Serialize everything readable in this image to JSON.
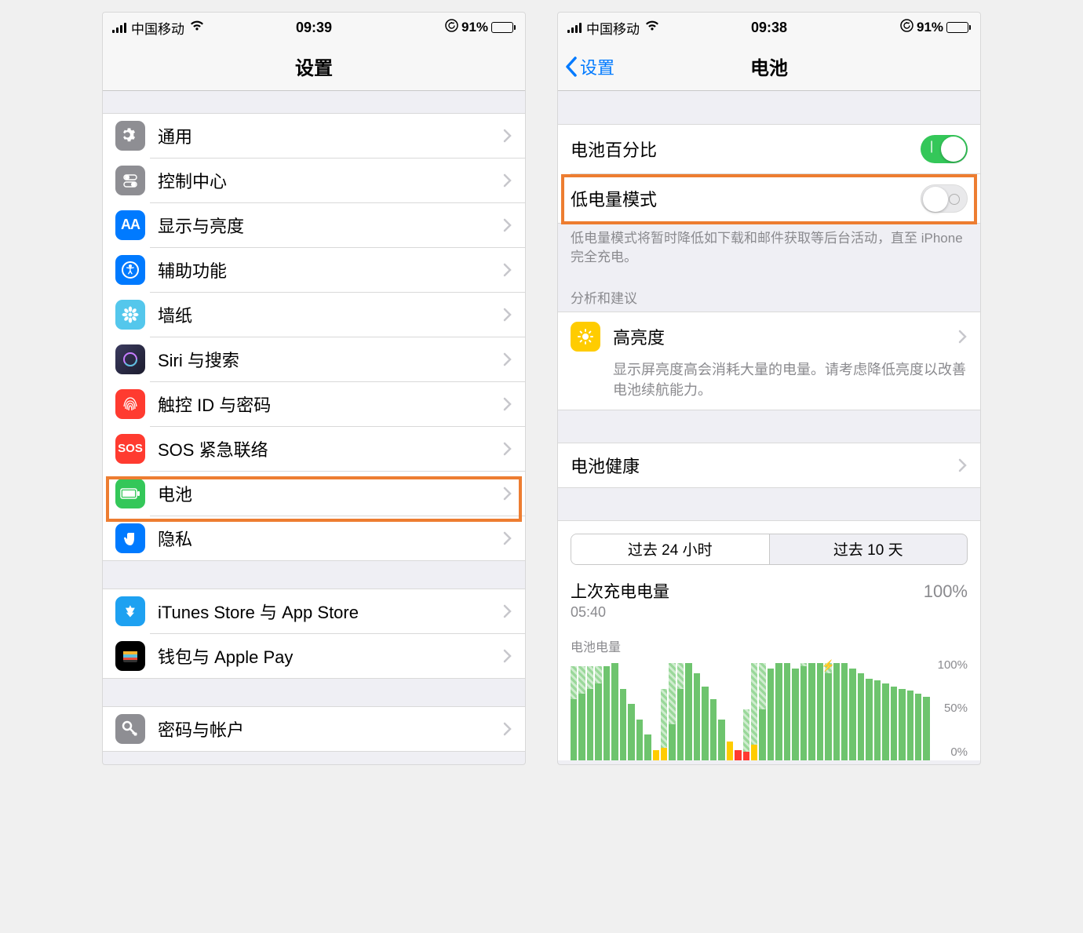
{
  "left": {
    "status": {
      "carrier": "中国移动",
      "time": "09:39",
      "battery": "91%"
    },
    "nav": {
      "title": "设置"
    },
    "items": [
      {
        "id": "general",
        "label": "通用"
      },
      {
        "id": "control",
        "label": "控制中心"
      },
      {
        "id": "display",
        "label": "显示与亮度"
      },
      {
        "id": "access",
        "label": "辅助功能"
      },
      {
        "id": "wallpaper",
        "label": "墙纸"
      },
      {
        "id": "siri",
        "label": "Siri 与搜索"
      },
      {
        "id": "touchid",
        "label": "触控 ID 与密码"
      },
      {
        "id": "sos",
        "label": "SOS 紧急联络"
      },
      {
        "id": "battery",
        "label": "电池"
      },
      {
        "id": "privacy",
        "label": "隐私"
      }
    ],
    "store_items": [
      {
        "id": "itunes",
        "label": "iTunes Store 与 App Store"
      },
      {
        "id": "wallet",
        "label": "钱包与 Apple Pay"
      }
    ],
    "accounts": [
      {
        "id": "passwords",
        "label": "密码与帐户"
      }
    ]
  },
  "right": {
    "status": {
      "carrier": "中国移动",
      "time": "09:38",
      "battery": "91%"
    },
    "nav": {
      "back": "设置",
      "title": "电池"
    },
    "toggles": {
      "percent_label": "电池百分比",
      "lowpower_label": "低电量模式",
      "lowpower_desc": "低电量模式将暂时降低如下载和邮件获取等后台活动，直至 iPhone 完全充电。"
    },
    "suggestions": {
      "header": "分析和建议",
      "title": "高亮度",
      "desc": "显示屏亮度高会消耗大量的电量。请考虑降低亮度以改善电池续航能力。"
    },
    "health_label": "电池健康",
    "segmented": {
      "t24": "过去 24 小时",
      "t10": "过去 10 天"
    },
    "last_charge": {
      "label": "上次充电电量",
      "time": "05:40",
      "pct": "100%"
    },
    "chart": {
      "label": "电池电量",
      "y": {
        "top": "100%",
        "mid": "50%",
        "bot": "0%"
      }
    }
  },
  "chart_data": {
    "type": "bar",
    "title": "电池电量",
    "ylabel": "%",
    "ylim": [
      0,
      100
    ],
    "series": [
      {
        "name": "battery_level",
        "values": [
          60,
          65,
          70,
          75,
          92,
          95,
          70,
          55,
          40,
          25,
          10,
          12,
          35,
          70,
          95,
          85,
          72,
          60,
          40,
          18,
          10,
          8,
          15,
          50,
          90,
          95,
          95,
          90,
          92,
          95,
          95,
          85,
          95,
          95,
          90,
          85,
          80,
          78,
          75,
          72,
          70,
          68,
          65,
          62
        ]
      },
      {
        "name": "charging_to",
        "values": [
          92,
          92,
          92,
          92,
          0,
          0,
          0,
          0,
          0,
          0,
          0,
          70,
          95,
          95,
          0,
          0,
          0,
          0,
          0,
          0,
          0,
          50,
          95,
          95,
          0,
          0,
          0,
          0,
          95,
          95,
          0,
          95,
          0,
          0,
          0,
          0,
          0,
          0,
          0,
          0,
          0,
          0,
          0,
          0
        ]
      },
      {
        "name": "low_power",
        "values": [
          0,
          0,
          0,
          0,
          0,
          0,
          0,
          0,
          0,
          0,
          10,
          12,
          0,
          0,
          0,
          0,
          0,
          0,
          0,
          18,
          10,
          8,
          15,
          0,
          0,
          0,
          0,
          0,
          0,
          0,
          0,
          0,
          0,
          0,
          0,
          0,
          0,
          0,
          0,
          0,
          0,
          0,
          0,
          0
        ]
      },
      {
        "name": "critical",
        "values": [
          0,
          0,
          0,
          0,
          0,
          0,
          0,
          0,
          0,
          0,
          0,
          0,
          0,
          0,
          0,
          0,
          0,
          0,
          0,
          0,
          10,
          8,
          0,
          0,
          0,
          0,
          0,
          0,
          0,
          0,
          0,
          0,
          0,
          0,
          0,
          0,
          0,
          0,
          0,
          0,
          0,
          0,
          0,
          0
        ]
      }
    ]
  }
}
